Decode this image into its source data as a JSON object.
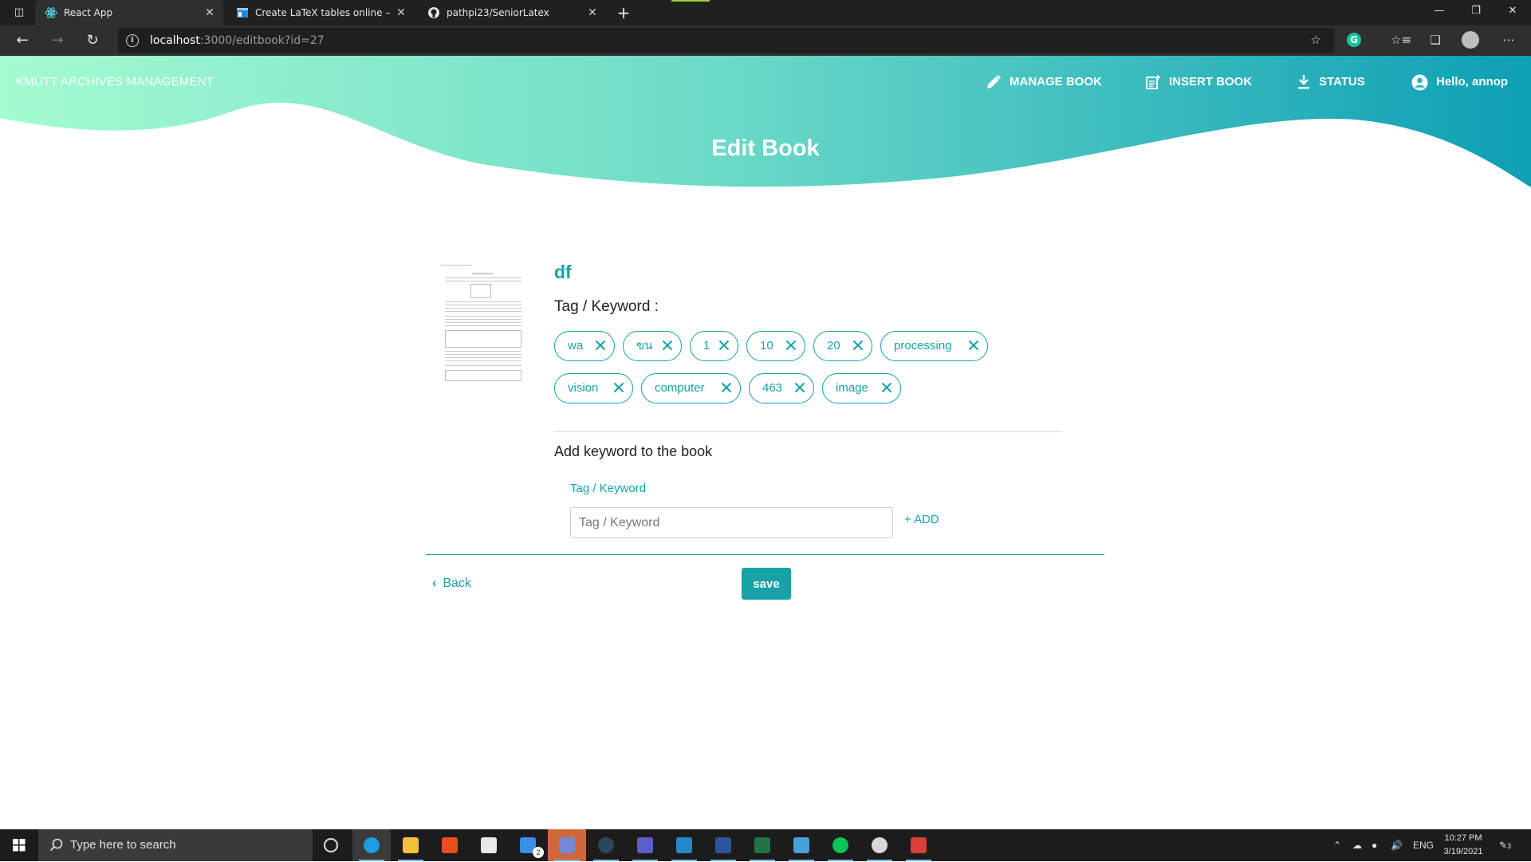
{
  "browser": {
    "tabs": [
      {
        "title": "React App",
        "icon": "react-icon",
        "active": true
      },
      {
        "title": "Create LaTeX tables online – Tabl",
        "icon": "tablesgenerator-icon",
        "active": false
      },
      {
        "title": "pathpi23/SeniorLatex",
        "icon": "github-icon",
        "active": false
      }
    ],
    "url_host": "localhost",
    "url_path": ":3000/editbook?id=27"
  },
  "app": {
    "brand": "KMUTT ARCHIVES MANAGEMENT",
    "nav": {
      "manage": "MANAGE BOOK",
      "insert": "INSERT BOOK",
      "status": "STATUS",
      "user": "Hello, annop"
    },
    "page_title": "Edit Book",
    "accent": "#17a2a8",
    "gradient_start": "#a4fbd0",
    "gradient_end": "#0d9fb5"
  },
  "book": {
    "title": "df",
    "tag_heading": "Tag / Keyword :",
    "tags": [
      "wa",
      "ขน",
      "1",
      "10",
      "20",
      "processing",
      "vision",
      "computer",
      "463",
      "image"
    ]
  },
  "add_keyword": {
    "heading": "Add keyword to the book",
    "label": "Tag / Keyword",
    "placeholder": "Tag / Keyword",
    "add_label": "+ ADD"
  },
  "footer_actions": {
    "back": "Back",
    "save": "save"
  },
  "taskbar": {
    "search_placeholder": "Type here to search",
    "language": "ENG",
    "time": "10:27 PM",
    "date": "3/19/2021",
    "notification_count": "3",
    "mail_badge": "2"
  }
}
